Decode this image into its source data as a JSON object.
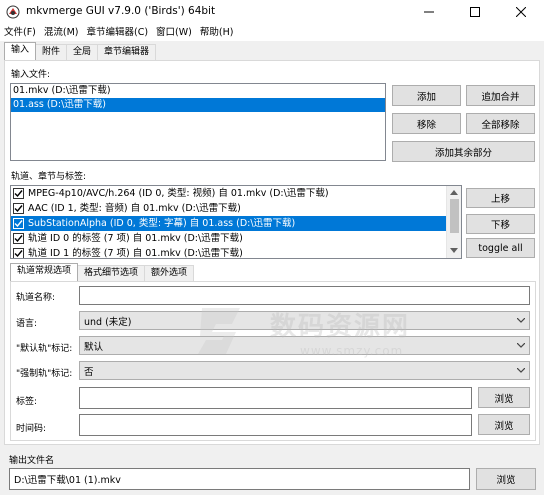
{
  "window": {
    "title": "mkvmerge GUI v7.9.0 ('Birds') 64bit",
    "minimize_icon": "minimize-icon",
    "maximize_icon": "maximize-icon",
    "close_icon": "close-icon"
  },
  "menu": [
    "文件(F)",
    "混流(M)",
    "章节编辑器(C)",
    "窗口(W)",
    "帮助(H)"
  ],
  "main_tabs": [
    "输入",
    "附件",
    "全局",
    "章节编辑器"
  ],
  "input": {
    "files_label": "输入文件:",
    "files": [
      {
        "text": "01.mkv (D:\\迅雷下载)",
        "selected": false
      },
      {
        "text": "01.ass (D:\\迅雷下载)",
        "selected": true
      }
    ],
    "buttons": {
      "add": "添加",
      "append": "追加合并",
      "remove": "移除",
      "remove_all": "全部移除",
      "add_other_parts": "添加其余部分"
    },
    "tracks_label": "轨道、章节与标签:",
    "tracks": [
      {
        "text": "MPEG-4p10/AVC/h.264 (ID 0, 类型: 视频) 自 01.mkv (D:\\迅雷下载)",
        "checked": true,
        "selected": false
      },
      {
        "text": "AAC (ID 1, 类型: 音频) 自 01.mkv (D:\\迅雷下载)",
        "checked": true,
        "selected": false
      },
      {
        "text": "SubStationAlpha (ID 0, 类型: 字幕) 自 01.ass (D:\\迅雷下载)",
        "checked": true,
        "selected": true
      },
      {
        "text": "轨道 ID 0 的标签 (7 项) 自 01.mkv (D:\\迅雷下载)",
        "checked": true,
        "selected": false
      },
      {
        "text": "轨道 ID 1 的标签 (7 项) 自 01.mkv (D:\\迅雷下载)",
        "checked": true,
        "selected": false
      }
    ],
    "track_buttons": {
      "up": "上移",
      "down": "下移",
      "toggle_all": "toggle all"
    },
    "sub_tabs": [
      "轨道常规选项",
      "格式细节选项",
      "额外选项"
    ],
    "fields": {
      "track_name_label": "轨道名称:",
      "track_name_value": "",
      "language_label": "语言:",
      "language_value": "und (未定)",
      "default_flag_label": "\"默认轨\"标记:",
      "default_flag_value": "默认",
      "forced_flag_label": "\"强制轨\"标记:",
      "forced_flag_value": "否",
      "tags_label": "标签:",
      "tags_value": "",
      "timecodes_label": "时间码:",
      "timecodes_value": "",
      "browse": "浏览"
    }
  },
  "output": {
    "label": "输出文件名",
    "value": "D:\\迅雷下载\\01 (1).mkv",
    "browse": "浏览"
  },
  "watermark": {
    "brand_text": "数码资源网",
    "url_text": "www.smzy.com"
  },
  "colors": {
    "selection": "#0078d7",
    "window_bg": "#f0f0f0",
    "button_bg": "#e1e1e1"
  }
}
